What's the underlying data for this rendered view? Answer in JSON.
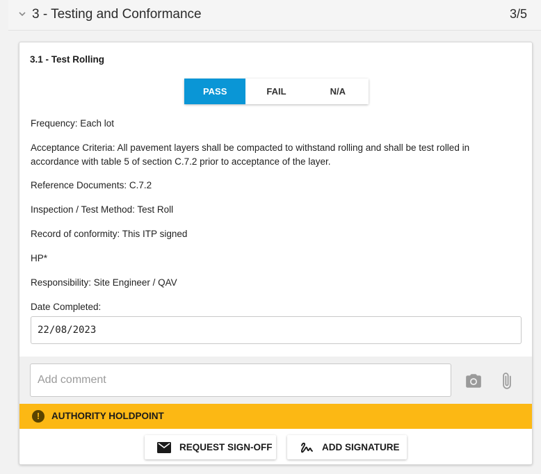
{
  "section": {
    "title": "3 - Testing and Conformance",
    "progress": "3/5"
  },
  "item": {
    "title": "3.1 - Test Rolling",
    "options": [
      {
        "label": "PASS",
        "selected": true
      },
      {
        "label": "FAIL",
        "selected": false
      },
      {
        "label": "N/A",
        "selected": false
      }
    ],
    "frequency": "Frequency: Each lot",
    "acceptance": "Acceptance Criteria: All pavement layers shall be compacted to withstand rolling and shall be test rolled in accordance with table 5 of section C.7.2 prior to acceptance of the layer.",
    "reference": "Reference Documents: C.7.2",
    "method": "Inspection / Test Method: Test Roll",
    "record": "Record of conformity: This ITP signed",
    "hold": "HP*",
    "responsibility": "Responsibility: Site Engineer / QAV",
    "date_label": "Date Completed:",
    "date_value": "22/08/2023"
  },
  "comment": {
    "placeholder": "Add comment",
    "value": ""
  },
  "icons": {
    "camera": "camera-icon",
    "attach": "paperclip-icon",
    "warning": "exclamation-circle-icon",
    "mail": "mail-icon",
    "signature": "signature-icon"
  },
  "holdpoint": {
    "label": "AUTHORITY HOLDPOINT",
    "color": "#fcb814"
  },
  "actions": {
    "request_signoff": "REQUEST SIGN-OFF",
    "add_signature": "ADD SIGNATURE"
  },
  "colors": {
    "accent": "#0a96d6",
    "holdpoint": "#fcb814"
  }
}
